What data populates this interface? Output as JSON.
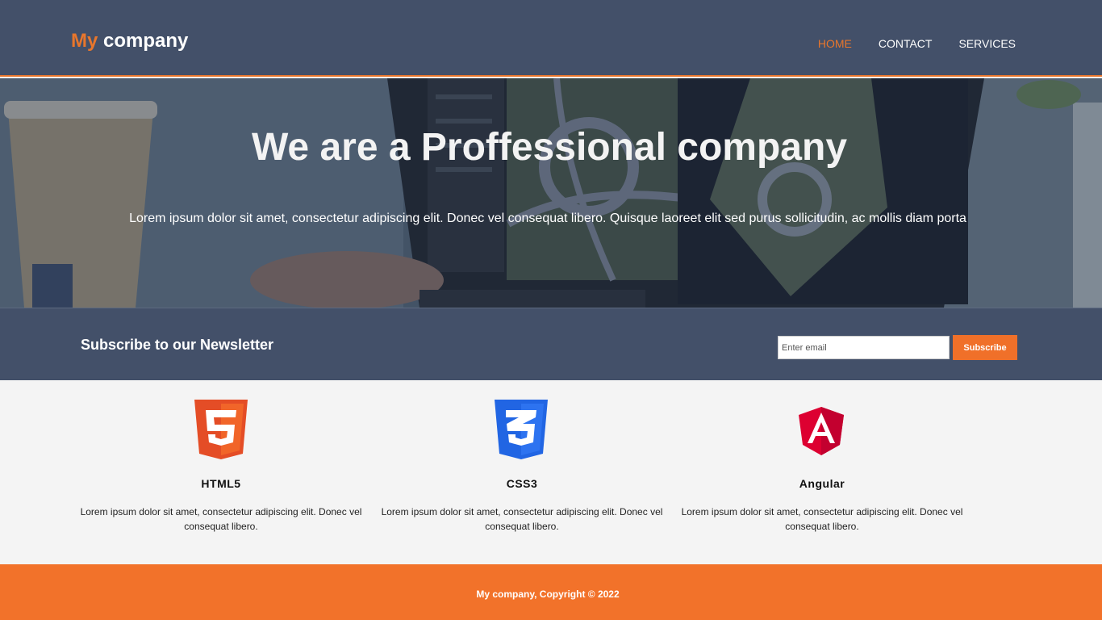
{
  "header": {
    "logo_accent": "My",
    "logo_rest": " company",
    "nav": [
      {
        "label": "HOME",
        "active": true
      },
      {
        "label": "CONTACT",
        "active": false
      },
      {
        "label": "SERVICES",
        "active": false
      }
    ]
  },
  "hero": {
    "title": "We are a Proffessional company",
    "text": "Lorem ipsum dolor sit amet, consectetur adipiscing elit. Donec vel consequat libero. Quisque laoreet elit sed purus sollicitudin, ac mollis diam porta"
  },
  "newsletter": {
    "title": "Subscribe to our Newsletter",
    "email_placeholder": "Enter email",
    "button_label": "Subscribe"
  },
  "features": [
    {
      "icon": "html5-icon",
      "title": "HTML5",
      "text": "Lorem ipsum dolor sit amet, consectetur adipiscing elit. Donec vel consequat libero."
    },
    {
      "icon": "css3-icon",
      "title": "CSS3",
      "text": "Lorem ipsum dolor sit amet, consectetur adipiscing elit. Donec vel consequat libero."
    },
    {
      "icon": "angular-icon",
      "title": "Angular",
      "text": "Lorem ipsum dolor sit amet, consectetur adipiscing elit. Donec vel consequat libero."
    }
  ],
  "footer": {
    "text": "My company, Copyright © 2022"
  },
  "colors": {
    "primary": "#435069",
    "accent": "#f2722a",
    "html5": "#e44d26",
    "css3": "#2165e3",
    "angular": "#dd0031"
  }
}
